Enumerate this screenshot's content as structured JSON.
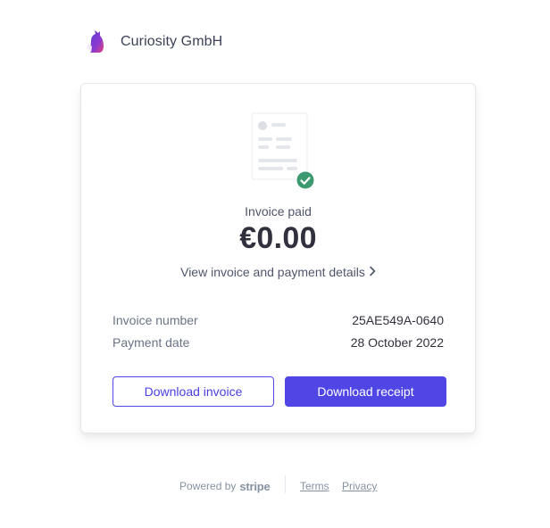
{
  "merchant": {
    "name": "Curiosity GmbH",
    "logo_icon": "curiosity-logo-icon"
  },
  "invoice": {
    "status": "Invoice paid",
    "amount": "€0.00",
    "details_link": "View invoice and payment details",
    "rows": [
      {
        "label": "Invoice number",
        "value": "25AE549A-0640"
      },
      {
        "label": "Payment date",
        "value": "28 October 2022"
      }
    ],
    "download_invoice_label": "Download invoice",
    "download_receipt_label": "Download receipt"
  },
  "footer": {
    "powered_by": "Powered by",
    "brand": "stripe",
    "terms": "Terms",
    "privacy": "Privacy"
  },
  "colors": {
    "accent": "#5046e5",
    "success": "#3d9970",
    "text": "#30313d",
    "muted": "#697386"
  }
}
